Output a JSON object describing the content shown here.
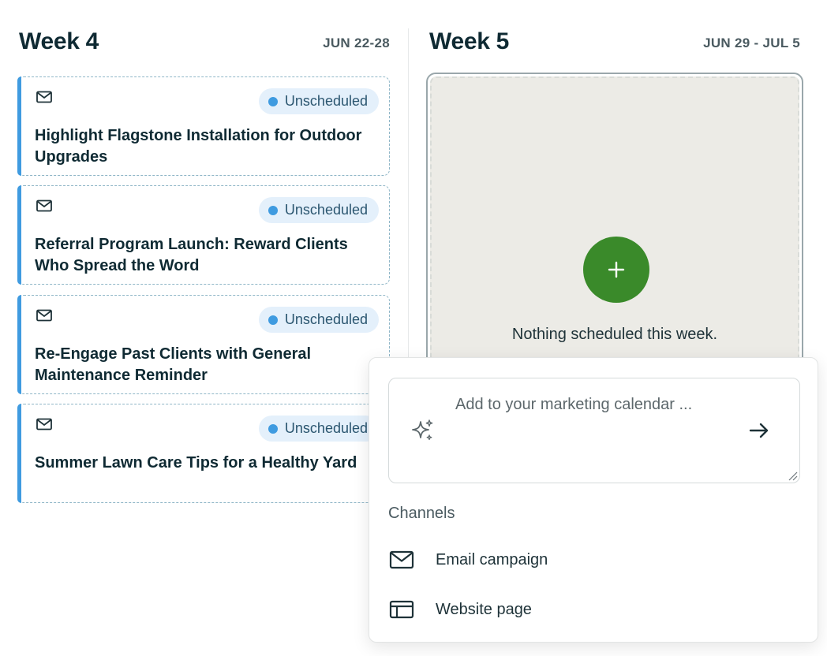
{
  "week4": {
    "title": "Week 4",
    "dates": "JUN 22-28",
    "cards": [
      {
        "status": "Unscheduled",
        "title": "Highlight Flagstone Installation for Outdoor Upgrades",
        "channel_icon": "mail-icon"
      },
      {
        "status": "Unscheduled",
        "title": "Referral Program Launch: Reward Clients Who Spread the Word",
        "channel_icon": "mail-icon"
      },
      {
        "status": "Unscheduled",
        "title": "Re-Engage Past Clients with General Maintenance Reminder",
        "channel_icon": "mail-icon"
      },
      {
        "status": "Unscheduled",
        "title": "Summer Lawn Care Tips for a Healthy Yard",
        "channel_icon": "mail-icon"
      }
    ]
  },
  "week5": {
    "title": "Week 5",
    "dates": "JUN 29 - JUL 5",
    "empty_text": "Nothing scheduled this week.",
    "add_icon": "plus-icon"
  },
  "popup": {
    "prompt_placeholder": "Add to your marketing calendar ...",
    "prompt_icon": "sparkle-icon",
    "send_icon": "arrow-right-icon",
    "channels_label": "Channels",
    "channels": [
      {
        "label": "Email campaign",
        "icon": "mail-icon"
      },
      {
        "label": "Website page",
        "icon": "layout-icon"
      }
    ]
  },
  "colors": {
    "accent_blue": "#3f9be0",
    "add_green": "#3a8a2a",
    "heading": "#0f2a33",
    "badge_bg": "#e4f0fb"
  }
}
